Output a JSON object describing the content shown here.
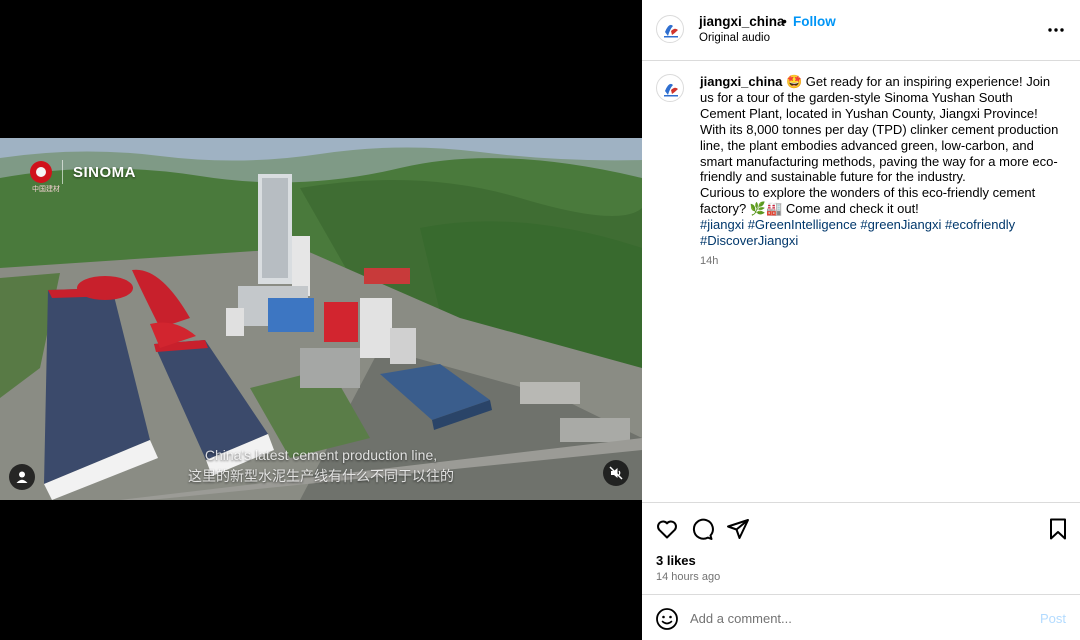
{
  "media": {
    "brand_logo_text": "SINOMA",
    "brand_logo_sub": "中国建材",
    "caption_en": "China's latest cement production line,",
    "caption_zh": "这里的新型水泥生产线有什么不同于以往的",
    "icons": {
      "user": "user-tag-icon",
      "mute": "speaker-muted-icon"
    }
  },
  "header": {
    "username": "jiangxi_china",
    "separator": "•",
    "follow_label": "Follow",
    "audio_label": "Original audio",
    "more_icon": "more-options-icon"
  },
  "post": {
    "username": "jiangxi_china",
    "body": "🤩 Get ready for an inspiring experience! Join us for a tour of the garden-style Sinoma Yushan South Cement Plant, located in Yushan County, Jiangxi Province!",
    "body2": "With its 8,000 tonnes per day (TPD) clinker cement production line, the plant embodies advanced green, low-carbon, and smart manufacturing methods, paving the way for a more eco-friendly and sustainable future for the industry.",
    "body3": "Curious to explore the wonders of this eco-friendly cement factory? 🌿🏭 Come and check it out!",
    "hashtags": "#jiangxi #GreenIntelligence #greenJiangxi #ecofriendly #DiscoverJiangxi",
    "time": "14h"
  },
  "actions": {
    "icons": [
      "heart-icon",
      "comment-icon",
      "share-icon",
      "bookmark-icon"
    ],
    "likes": "3 likes",
    "time_ago": "14 hours ago"
  },
  "comment": {
    "placeholder": "Add a comment...",
    "post_label": "Post",
    "emoji_icon": "emoji-icon"
  },
  "colors": {
    "follow": "#0095f6",
    "hashtag": "#00376b",
    "muted_text": "#737373",
    "post_disabled": "#b3dbff",
    "brand_red": "#d0121b"
  }
}
